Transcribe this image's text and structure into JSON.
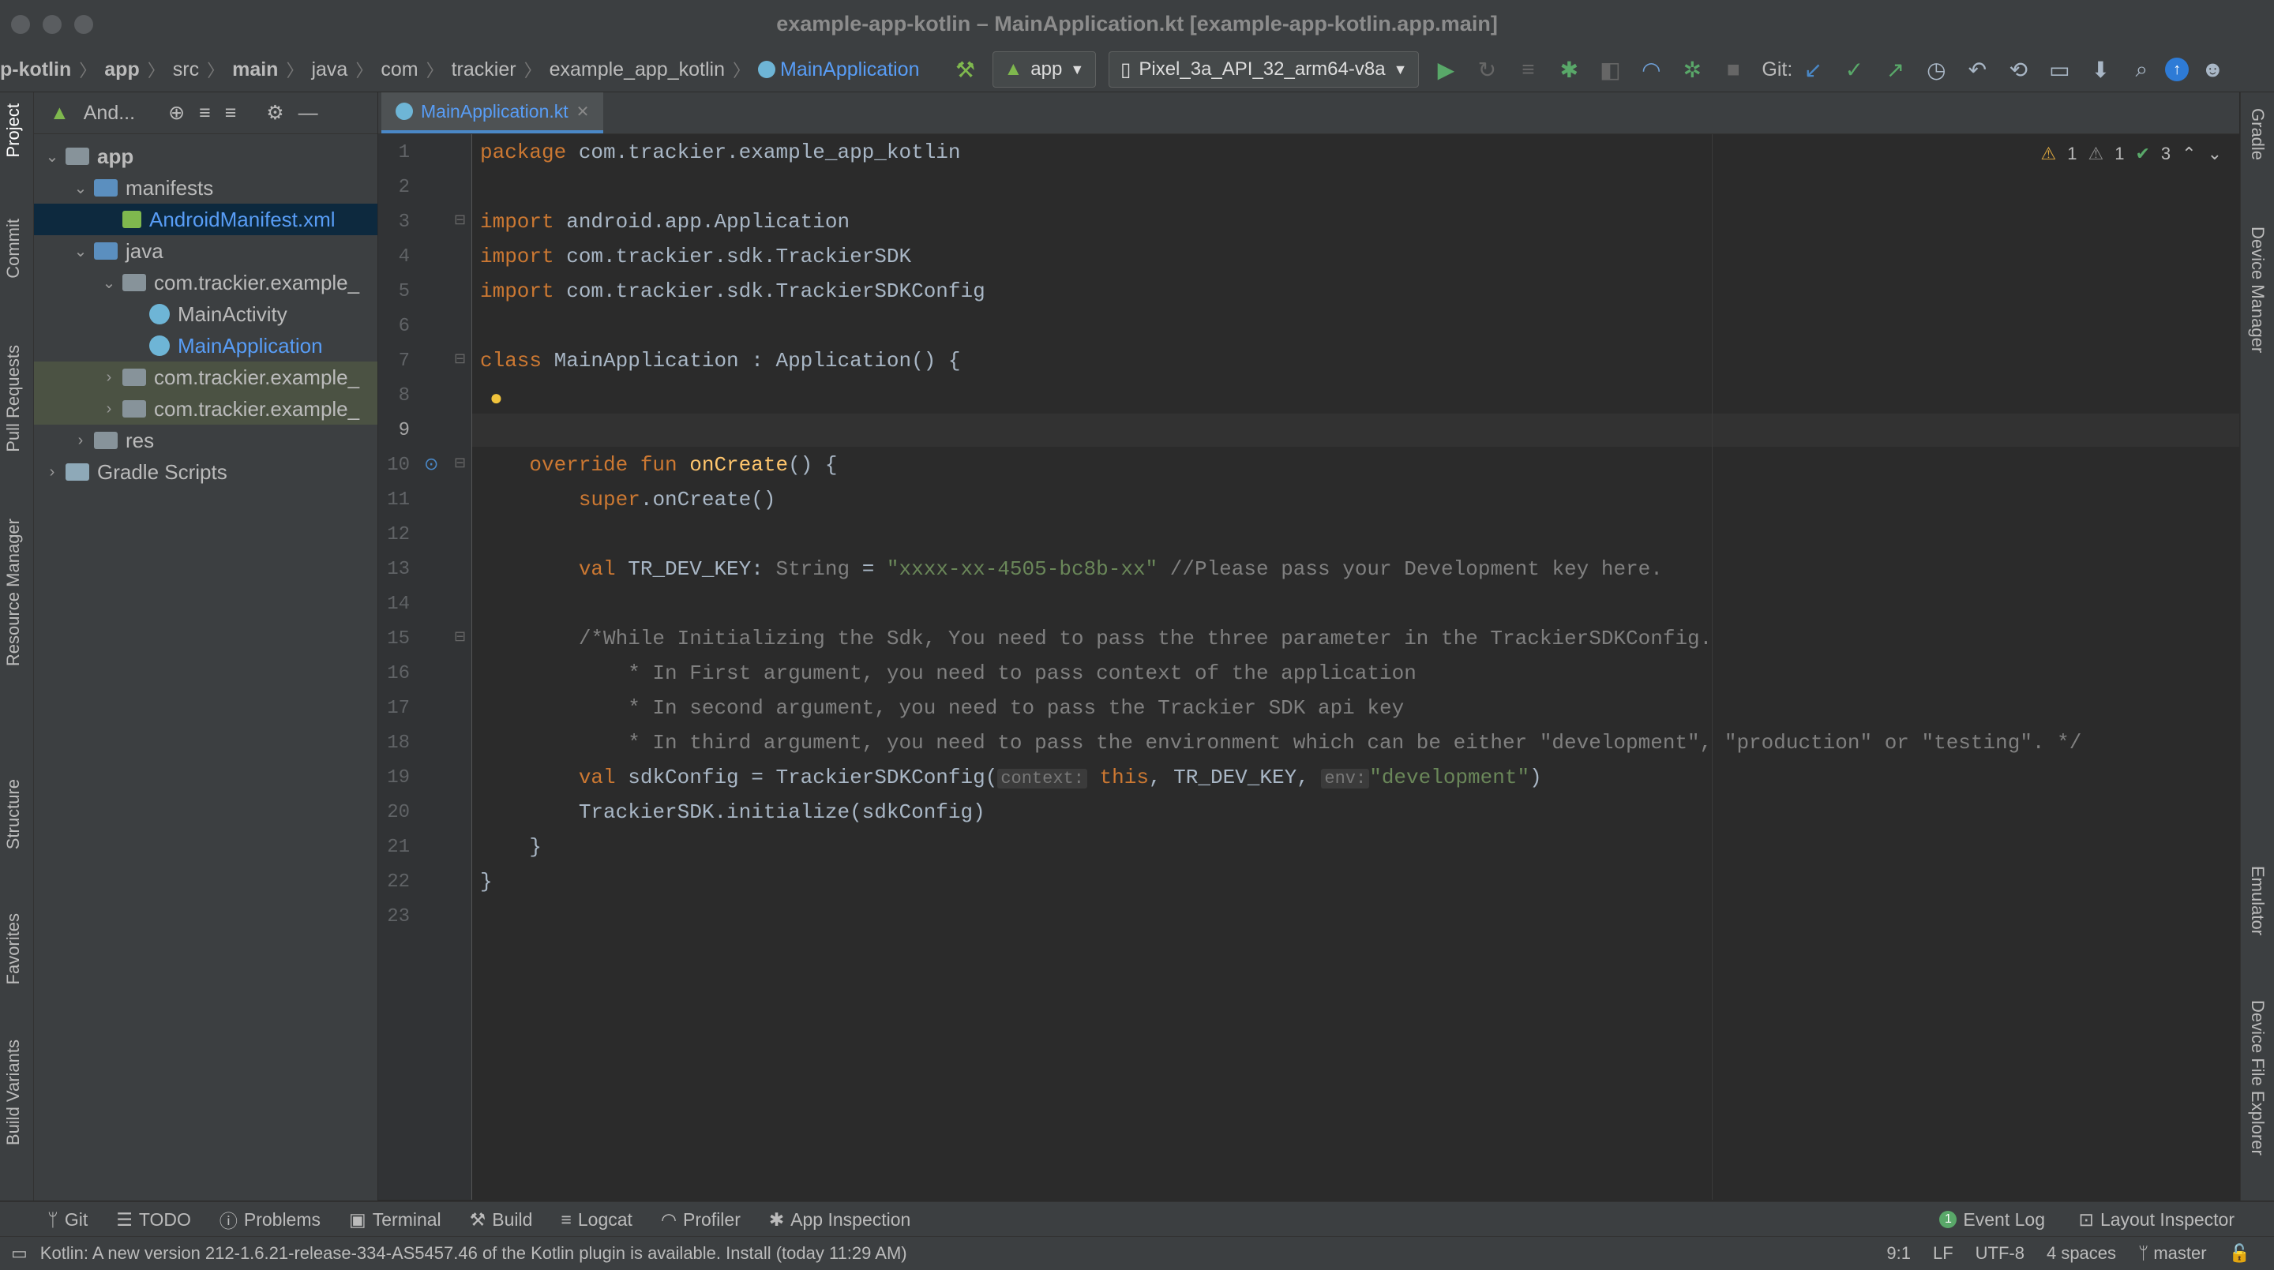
{
  "window": {
    "title": "example-app-kotlin – MainApplication.kt [example-app-kotlin.app.main]"
  },
  "breadcrumbs": [
    "p-kotlin",
    "app",
    "src",
    "main",
    "java",
    "com",
    "trackier",
    "example_app_kotlin",
    "MainApplication"
  ],
  "toolbar": {
    "run_config": "app",
    "device": "Pixel_3a_API_32_arm64-v8a",
    "git_label": "Git:"
  },
  "project_panel": {
    "view_label": "And...",
    "tree": [
      {
        "label": "app",
        "level": 0,
        "expanded": true
      },
      {
        "label": "manifests",
        "level": 1,
        "expanded": true
      },
      {
        "label": "AndroidManifest.xml",
        "level": 2,
        "selected": true
      },
      {
        "label": "java",
        "level": 1,
        "expanded": true
      },
      {
        "label": "com.trackier.example_",
        "level": 2,
        "expanded": true
      },
      {
        "label": "MainActivity",
        "level": 3
      },
      {
        "label": "MainApplication",
        "level": 3
      },
      {
        "label": "com.trackier.example_",
        "level": 2
      },
      {
        "label": "com.trackier.example_",
        "level": 2
      },
      {
        "label": "res",
        "level": 1
      },
      {
        "label": "Gradle Scripts",
        "level": 0
      }
    ]
  },
  "left_tool_tabs": [
    "Project",
    "Commit",
    "Pull Requests",
    "Resource Manager",
    "Structure",
    "Favorites",
    "Build Variants"
  ],
  "right_tool_tabs": [
    "Gradle",
    "Device Manager",
    "Emulator",
    "Device File Explorer"
  ],
  "editor": {
    "tab_label": "MainApplication.kt",
    "inspections": {
      "warnings": "1",
      "weak_warnings": "1",
      "ok": "3"
    },
    "lines": {
      "l1a": "package",
      "l1b": " com.trackier.example_app_kotlin",
      "l3a": "import",
      "l3b": " android.app.Application",
      "l4a": "import",
      "l4b": " com.trackier.sdk.TrackierSDK",
      "l5a": "import",
      "l5b": " com.trackier.sdk.TrackierSDKConfig",
      "l7a": "class",
      "l7b": " MainApplication : Application() {",
      "l10a": "    override fun ",
      "l10b": "onCreate",
      "l10c": "() {",
      "l11a": "        super",
      "l11b": ".onCreate()",
      "l13a": "        val ",
      "l13b": "TR_DEV_KEY: ",
      "l13c": "String",
      "l13d": " = ",
      "l13e": "\"xxxx-xx-4505-bc8b-xx\"",
      "l13f": " //Please pass your Development key here.",
      "l15": "        /*While Initializing the Sdk, You need to pass the three parameter in the TrackierSDKConfig.",
      "l16": "            * In First argument, you need to pass context of the application",
      "l17": "            * In second argument, you need to pass the Trackier SDK api key",
      "l18": "            * In third argument, you need to pass the environment which can be either \"development\", \"production\" or \"testing\". */",
      "l19a": "        val ",
      "l19b": "sdkConfig = TrackierSDKConfig(",
      "l19c": "context:",
      "l19d": "this",
      "l19e": ", TR_DEV_KEY, ",
      "l19f": "env:",
      "l19g": "\"development\"",
      "l19h": ")",
      "l20": "        TrackierSDK.initialize(sdkConfig)",
      "l21": "    }",
      "l22": "}"
    }
  },
  "bottom_tools": [
    "Git",
    "TODO",
    "Problems",
    "Terminal",
    "Build",
    "Logcat",
    "Profiler",
    "App Inspection"
  ],
  "bottom_tools_right": [
    "Event Log",
    "Layout Inspector"
  ],
  "event_log_count": "1",
  "status": {
    "message": "Kotlin: A new version 212-1.6.21-release-334-AS5457.46 of the Kotlin plugin is available. Install (today 11:29 AM)",
    "position": "9:1",
    "line_sep": "LF",
    "encoding": "UTF-8",
    "indent": "4 spaces",
    "branch": "master"
  },
  "colors": {
    "accent": "#4a88c7",
    "keyword": "#cc7832",
    "string": "#6a8759",
    "function": "#ffc66d"
  }
}
